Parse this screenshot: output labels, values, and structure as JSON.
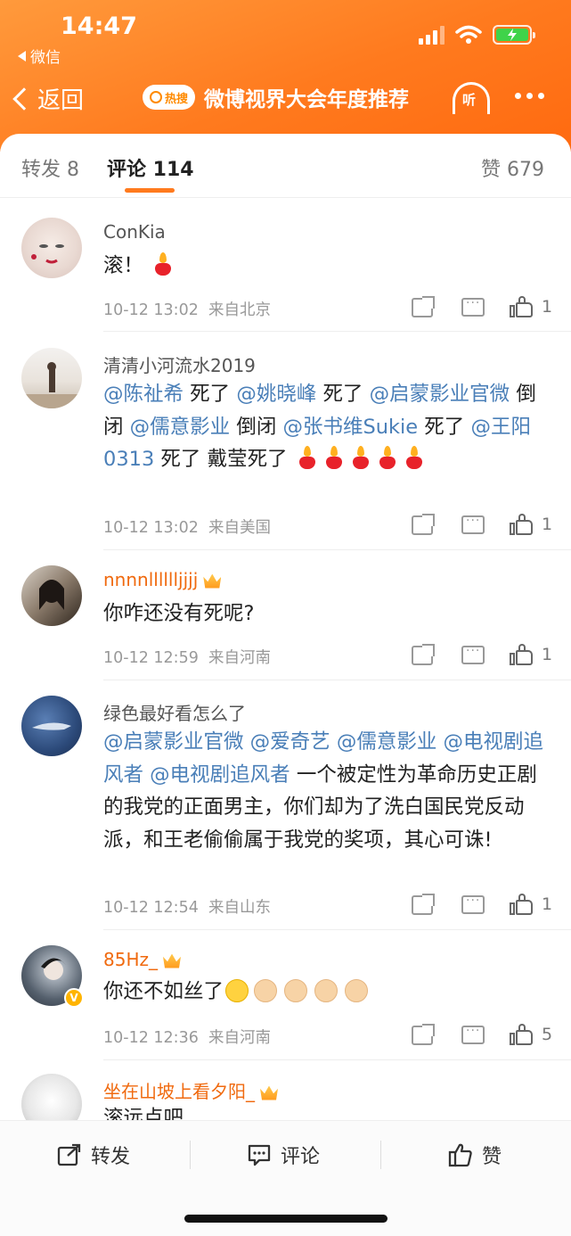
{
  "status_bar": {
    "time": "14:47",
    "back_app": "微信"
  },
  "nav": {
    "back_label": "返回",
    "hot_badge": "热搜",
    "title": "微博视界大会年度推荐",
    "listen_label": "听"
  },
  "tabs": {
    "repost": "转发 8",
    "comments": "评论 114",
    "likes": "赞 679"
  },
  "comments": [
    {
      "user": "ConKia",
      "vip": false,
      "text": "滚！",
      "time": "10-12 13:02",
      "location": "来自北京",
      "likes": "1"
    },
    {
      "user": "清清小河流水2019",
      "vip": false,
      "mention1": "@陈祉希",
      "t1": " 死了 ",
      "mention2": "@姚晓峰",
      "t2": " 死了 ",
      "mention3": "@启蒙影业官微",
      "t3": " 倒闭 ",
      "mention4": "@儒意影业",
      "t4": " 倒闭 ",
      "mention5": "@张书维Sukie",
      "t5": " 死了 ",
      "mention6": "@王阳0313",
      "t6": " 死了 戴莹死了 ",
      "time": "10-12 13:02",
      "location": "来自美国",
      "likes": "1"
    },
    {
      "user": "nnnnlllllljjjj",
      "vip": true,
      "text": "你咋还没有死呢?",
      "time": "10-12 12:59",
      "location": "来自河南",
      "likes": "1"
    },
    {
      "user": "绿色最好看怎么了",
      "vip": false,
      "mention1": "@启蒙影业官微",
      "mention2": "@爱奇艺",
      "mention3": "@儒意影业",
      "mention4": "@电视剧追风者",
      "mention5": "@电视剧追风者",
      "text": " 一个被定性为革命历史正剧的我党的正面男主，你们却为了洗白国民党反动派，和王老偷偷属于我党的奖项，其心可诛!",
      "time": "10-12 12:54",
      "location": "来自山东",
      "likes": "1"
    },
    {
      "user": "85Hz_",
      "vip": true,
      "text": "你还不如丝了",
      "time": "10-12 12:36",
      "location": "来自河南",
      "likes": "5"
    },
    {
      "user": "坐在山坡上看夕阳_",
      "vip": true,
      "text": "滚远点吧"
    }
  ],
  "bottom_bar": {
    "repost": "转发",
    "comment": "评论",
    "like": "赞"
  },
  "colors": {
    "header_orange": "#ff7a1e",
    "mention_blue": "#4a7fb8",
    "vip_name": "#f06a0f"
  }
}
